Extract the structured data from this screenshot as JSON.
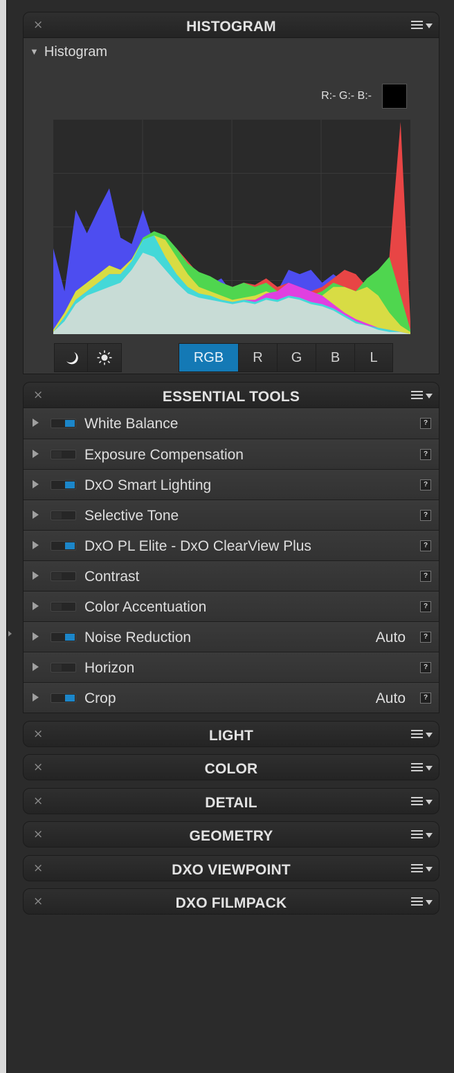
{
  "histogram_panel": {
    "title": "HISTOGRAM",
    "close_glyph": "×",
    "subheader": "Histogram",
    "rgb_readout": "R:- G:- B:-",
    "swatch_color": "#000000",
    "buttons": {
      "dark_icon": "moon-icon",
      "light_icon": "sun-icon",
      "channels": [
        "RGB",
        "R",
        "G",
        "B",
        "L"
      ],
      "active_channel": "RGB"
    }
  },
  "chart_data": {
    "type": "area",
    "x": [
      0,
      8,
      16,
      24,
      32,
      40,
      48,
      56,
      64,
      72,
      80,
      88,
      96,
      104,
      112,
      120,
      128,
      136,
      144,
      152,
      160,
      168,
      176,
      184,
      192,
      200,
      208,
      216,
      224,
      232,
      240,
      248,
      255
    ],
    "series": [
      {
        "color": "#4d4df0",
        "values": [
          0.4,
          0.2,
          0.58,
          0.47,
          0.58,
          0.68,
          0.45,
          0.42,
          0.58,
          0.42,
          0.38,
          0.3,
          0.25,
          0.24,
          0.23,
          0.26,
          0.19,
          0.2,
          0.18,
          0.22,
          0.2,
          0.3,
          0.28,
          0.3,
          0.24,
          0.28,
          0.24,
          0.18,
          0.16,
          0.18,
          0.1,
          0.06,
          0.02
        ]
      },
      {
        "color": "#e84545",
        "values": [
          0.02,
          0.1,
          0.2,
          0.24,
          0.28,
          0.32,
          0.3,
          0.35,
          0.44,
          0.47,
          0.44,
          0.4,
          0.34,
          0.28,
          0.25,
          0.24,
          0.22,
          0.24,
          0.23,
          0.26,
          0.22,
          0.24,
          0.22,
          0.2,
          0.22,
          0.26,
          0.3,
          0.28,
          0.22,
          0.2,
          0.36,
          0.99,
          0.06
        ]
      },
      {
        "color": "#4fd64f",
        "values": [
          0.02,
          0.1,
          0.2,
          0.24,
          0.28,
          0.32,
          0.3,
          0.35,
          0.45,
          0.48,
          0.46,
          0.4,
          0.33,
          0.29,
          0.27,
          0.24,
          0.22,
          0.24,
          0.22,
          0.24,
          0.2,
          0.22,
          0.2,
          0.18,
          0.2,
          0.24,
          0.22,
          0.2,
          0.26,
          0.3,
          0.36,
          0.18,
          0.02
        ]
      },
      {
        "color": "#d8dc44",
        "values": [
          0.02,
          0.1,
          0.2,
          0.24,
          0.28,
          0.32,
          0.3,
          0.35,
          0.44,
          0.46,
          0.44,
          0.36,
          0.28,
          0.22,
          0.2,
          0.18,
          0.16,
          0.17,
          0.18,
          0.2,
          0.18,
          0.2,
          0.18,
          0.16,
          0.18,
          0.22,
          0.22,
          0.2,
          0.22,
          0.18,
          0.1,
          0.04,
          0.01
        ]
      },
      {
        "color": "#e040e0",
        "values": [
          0.01,
          0.08,
          0.16,
          0.2,
          0.24,
          0.28,
          0.28,
          0.34,
          0.4,
          0.38,
          0.32,
          0.26,
          0.2,
          0.18,
          0.17,
          0.16,
          0.15,
          0.16,
          0.16,
          0.19,
          0.2,
          0.24,
          0.22,
          0.2,
          0.18,
          0.14,
          0.1,
          0.07,
          0.05,
          0.03,
          0.02,
          0.01,
          0.0
        ]
      },
      {
        "color": "#44d8d8",
        "values": [
          0.01,
          0.08,
          0.16,
          0.2,
          0.24,
          0.28,
          0.28,
          0.34,
          0.44,
          0.46,
          0.36,
          0.28,
          0.22,
          0.19,
          0.18,
          0.16,
          0.15,
          0.16,
          0.15,
          0.17,
          0.16,
          0.18,
          0.17,
          0.15,
          0.14,
          0.12,
          0.09,
          0.06,
          0.04,
          0.03,
          0.02,
          0.01,
          0.0
        ]
      },
      {
        "color": "#c8dcd6",
        "values": [
          0.01,
          0.06,
          0.14,
          0.18,
          0.2,
          0.22,
          0.24,
          0.3,
          0.38,
          0.36,
          0.3,
          0.24,
          0.19,
          0.17,
          0.16,
          0.15,
          0.14,
          0.15,
          0.14,
          0.16,
          0.15,
          0.17,
          0.16,
          0.14,
          0.13,
          0.11,
          0.08,
          0.05,
          0.04,
          0.02,
          0.01,
          0.01,
          0.0
        ]
      }
    ],
    "xlim": [
      0,
      255
    ],
    "ylim": [
      0,
      1
    ],
    "grid": true,
    "background": "#2a2a2a",
    "grid_color": "#3a3a3a"
  },
  "essential_tools_panel": {
    "title": "ESSENTIAL TOOLS",
    "close_glyph": "×",
    "help_glyph": "?",
    "items": [
      {
        "label": "White Balance",
        "enabled": true,
        "value": ""
      },
      {
        "label": "Exposure Compensation",
        "enabled": false,
        "value": ""
      },
      {
        "label": "DxO Smart Lighting",
        "enabled": true,
        "value": ""
      },
      {
        "label": "Selective Tone",
        "enabled": false,
        "value": ""
      },
      {
        "label": "DxO PL Elite - DxO ClearView Plus",
        "enabled": true,
        "value": ""
      },
      {
        "label": "Contrast",
        "enabled": false,
        "value": ""
      },
      {
        "label": "Color Accentuation",
        "enabled": false,
        "value": ""
      },
      {
        "label": "Noise Reduction",
        "enabled": true,
        "value": "Auto"
      },
      {
        "label": "Horizon",
        "enabled": false,
        "value": ""
      },
      {
        "label": "Crop",
        "enabled": true,
        "value": "Auto"
      }
    ]
  },
  "collapsed_panels": [
    {
      "title": "LIGHT",
      "close_glyph": "×"
    },
    {
      "title": "COLOR",
      "close_glyph": "×"
    },
    {
      "title": "DETAIL",
      "close_glyph": "×"
    },
    {
      "title": "GEOMETRY",
      "close_glyph": "×"
    },
    {
      "title": "DXO VIEWPOINT",
      "close_glyph": "×"
    },
    {
      "title": "DXO FILMPACK",
      "close_glyph": "×"
    }
  ],
  "colors": {
    "accent": "#1479b5",
    "toggle_on": "#1c86c9",
    "panel_bg": "#2b2b2b"
  }
}
